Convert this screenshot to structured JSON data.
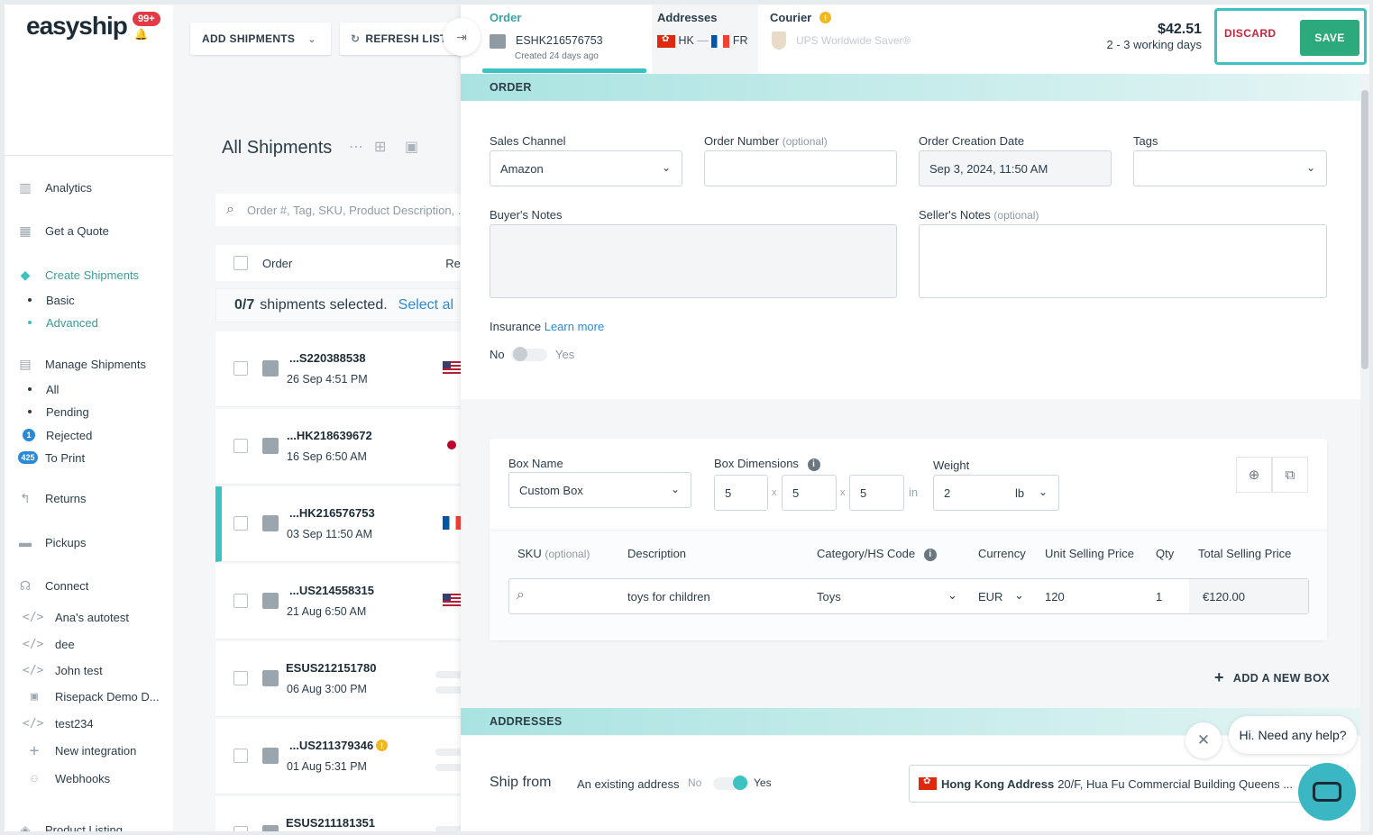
{
  "sidebar": {
    "logo": "easyship",
    "notifications_badge": "99+",
    "items": [
      {
        "label": "Analytics",
        "icon": "analytics-icon"
      },
      {
        "label": "Get a Quote",
        "icon": "calculator-icon"
      },
      {
        "label": "Create Shipments",
        "icon": "box-icon"
      },
      {
        "label": "Manage Shipments",
        "icon": "barcode-icon"
      },
      {
        "label": "Returns",
        "icon": "return-icon"
      },
      {
        "label": "Pickups",
        "icon": "truck-icon"
      },
      {
        "label": "Connect",
        "icon": "plug-icon"
      },
      {
        "label": "Product Listing",
        "icon": "tag-icon"
      }
    ],
    "create_sub": [
      "Basic",
      "Advanced"
    ],
    "manage_sub": [
      {
        "label": "All"
      },
      {
        "label": "Pending"
      },
      {
        "label": "Rejected",
        "count": "1"
      },
      {
        "label": "To Print",
        "count": "425"
      }
    ],
    "integrations": [
      "Ana's autotest",
      "dee",
      "John test",
      "Risepack Demo D...",
      "test234",
      "New integration",
      "Webhooks"
    ]
  },
  "toolbar": {
    "add_shipments": "ADD SHIPMENTS",
    "refresh_list": "REFRESH LIST"
  },
  "shipments": {
    "title": "All Shipments",
    "search_placeholder": "Order #, Tag, SKU, Product Description, ...",
    "col_order": "Order",
    "col_receiver": "Rec",
    "selected_count": "0/7",
    "selected_text": "shipments selected.",
    "select_all": "Select al",
    "rows": [
      {
        "id": "...S220388538",
        "date": "26 Sep 4:51 PM",
        "flag": "us"
      },
      {
        "id": "...HK218639672",
        "date": "16 Sep 6:50 AM",
        "flag": "jp"
      },
      {
        "id": "...HK216576753",
        "date": "03 Sep 11:50 AM",
        "flag": "fr"
      },
      {
        "id": "...US214558315",
        "date": "21 Aug 6:50 AM",
        "flag": "us"
      },
      {
        "id": "ESUS212151780",
        "date": "06 Aug 3:00 PM",
        "flag": ""
      },
      {
        "id": "...US211379346",
        "date": "01 Aug 5:31 PM",
        "flag": ""
      },
      {
        "id": "ESUS211181351",
        "date": "",
        "flag": ""
      }
    ]
  },
  "panel": {
    "tabs": {
      "order_label": "Order",
      "order_id": "ESHK216576753",
      "order_created": "Created 24 days ago",
      "addresses_label": "Addresses",
      "from_code": "HK",
      "to_code": "FR",
      "courier_label": "Courier",
      "courier_name": "UPS Worldwide Saver®"
    },
    "price": "$42.51",
    "delivery": "2 - 3 working days",
    "discard": "DISCARD",
    "save": "SAVE",
    "order_section": "ORDER",
    "sales_channel_label": "Sales Channel",
    "sales_channel_value": "Amazon",
    "order_number_label": "Order Number",
    "optional": "(optional)",
    "order_number_value": "",
    "creation_date_label": "Order Creation Date",
    "creation_date_value": "Sep 3, 2024, 11:50 AM",
    "tags_label": "Tags",
    "buyers_notes_label": "Buyer's Notes",
    "sellers_notes_label": "Seller's Notes",
    "insurance_label": "Insurance",
    "learn_more": "Learn more",
    "no": "No",
    "yes": "Yes",
    "box": {
      "name_label": "Box Name",
      "name_value": "Custom Box",
      "dims_label": "Box Dimensions",
      "dims": [
        "5",
        "5",
        "5"
      ],
      "dims_sep": "x",
      "dims_unit": "in",
      "weight_label": "Weight",
      "weight_value": "2",
      "weight_unit": "lb"
    },
    "items": {
      "col_sku": "SKU",
      "col_description": "Description",
      "col_category": "Category/HS Code",
      "col_currency": "Currency",
      "col_unit_price": "Unit Selling Price",
      "col_qty": "Qty",
      "col_total": "Total Selling Price",
      "row": {
        "description": "toys for children",
        "category": "Toys",
        "currency": "EUR",
        "unit_price": "120",
        "qty": "1",
        "total": "€120.00"
      }
    },
    "add_box": "ADD A NEW BOX",
    "addresses_section": "ADDRESSES",
    "ship_from_label": "Ship from",
    "existing_address": "An existing address",
    "address_name": "Hong Kong Address",
    "address_detail": "20/F, Hua Fu Commercial Building Queens ..."
  },
  "chat": {
    "greeting": "Hi. Need any help?"
  }
}
